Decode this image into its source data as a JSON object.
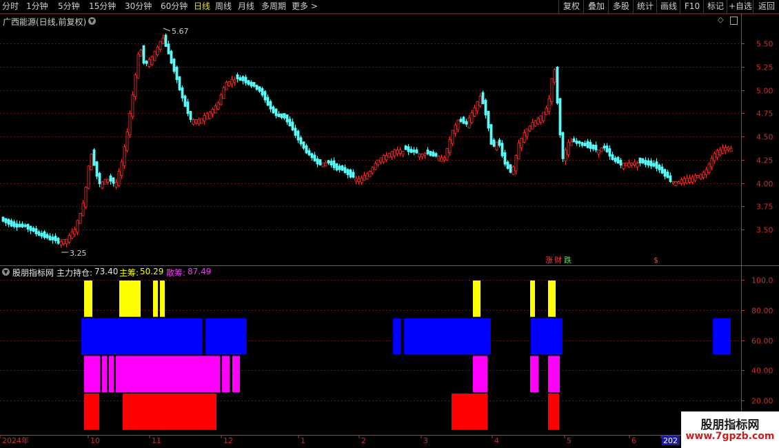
{
  "toolbar": {
    "periods": [
      {
        "label": "分时",
        "active": false
      },
      {
        "label": "1分钟",
        "active": false
      },
      {
        "label": "5分钟",
        "active": false
      },
      {
        "label": "15分钟",
        "active": false
      },
      {
        "label": "30分钟",
        "active": false
      },
      {
        "label": "60分钟",
        "active": false
      },
      {
        "label": "日线",
        "active": true
      },
      {
        "label": "周线",
        "active": false
      },
      {
        "label": "月线",
        "active": false
      },
      {
        "label": "多周期",
        "active": false
      },
      {
        "label": "更多 >",
        "active": false
      }
    ],
    "right_buttons": [
      "复权",
      "叠加",
      "多股",
      "统计",
      "画线",
      "F10",
      "标记",
      "+自选",
      "返回"
    ]
  },
  "main_chart": {
    "title": "广西能源(日线,前复权)",
    "y_ticks": [
      "5.50",
      "5.25",
      "5.00",
      "4.75",
      "4.50",
      "4.25",
      "4.00",
      "3.75",
      "3.50"
    ],
    "y_range": [
      3.25,
      5.8
    ],
    "high_label": "5.67",
    "low_label": "3.25",
    "event_labels": {
      "rise": "涨",
      "finance": "财",
      "fall": "跌",
      "dollar": "$"
    },
    "colors": {
      "up": "#ff3232",
      "down": "#54fcfc",
      "grid": "#8b1a1a",
      "axis": "#c83232"
    }
  },
  "indicator": {
    "name": "股朋指标网",
    "items": [
      {
        "label": "主力持仓:",
        "value": "73.40",
        "color": "#e8e8e8"
      },
      {
        "label": "主筹:",
        "value": "50.29",
        "color": "#ffff00"
      },
      {
        "label": "散筹:",
        "value": "87.49",
        "color": "#ff33ff"
      }
    ],
    "y_ticks": [
      "100.0",
      "80.00",
      "60.00",
      "40.00",
      "20.00"
    ],
    "y_range": [
      0,
      108
    ],
    "blocks": [
      {
        "color": "yellow",
        "x0": 122,
        "x1": 134,
        "y0": 75,
        "y1": 100
      },
      {
        "color": "yellow",
        "x0": 173,
        "x1": 204,
        "y0": 75,
        "y1": 100
      },
      {
        "color": "yellow",
        "x0": 222,
        "x1": 229,
        "y0": 75,
        "y1": 100
      },
      {
        "color": "yellow",
        "x0": 232,
        "x1": 239,
        "y0": 75,
        "y1": 100
      },
      {
        "color": "yellow",
        "x0": 686,
        "x1": 697,
        "y0": 75,
        "y1": 100
      },
      {
        "color": "yellow",
        "x0": 769,
        "x1": 776,
        "y0": 75,
        "y1": 100
      },
      {
        "color": "yellow",
        "x0": 795,
        "x1": 806,
        "y0": 75,
        "y1": 100
      },
      {
        "color": "blue",
        "x0": 118,
        "x1": 294,
        "y0": 50,
        "y1": 75
      },
      {
        "color": "blue",
        "x0": 298,
        "x1": 358,
        "y0": 50,
        "y1": 75
      },
      {
        "color": "blue",
        "x0": 570,
        "x1": 582,
        "y0": 50,
        "y1": 75
      },
      {
        "color": "blue",
        "x0": 586,
        "x1": 712,
        "y0": 50,
        "y1": 75
      },
      {
        "color": "blue",
        "x0": 770,
        "x1": 816,
        "y0": 50,
        "y1": 75
      },
      {
        "color": "blue",
        "x0": 1034,
        "x1": 1060,
        "y0": 50,
        "y1": 75
      },
      {
        "color": "magenta",
        "x0": 122,
        "x1": 145,
        "y0": 25,
        "y1": 50
      },
      {
        "color": "magenta",
        "x0": 148,
        "x1": 155,
        "y0": 25,
        "y1": 50
      },
      {
        "color": "magenta",
        "x0": 158,
        "x1": 165,
        "y0": 25,
        "y1": 50
      },
      {
        "color": "magenta",
        "x0": 168,
        "x1": 319,
        "y0": 25,
        "y1": 50
      },
      {
        "color": "magenta",
        "x0": 322,
        "x1": 333,
        "y0": 25,
        "y1": 50
      },
      {
        "color": "magenta",
        "x0": 337,
        "x1": 348,
        "y0": 25,
        "y1": 50
      },
      {
        "color": "magenta",
        "x0": 686,
        "x1": 707,
        "y0": 25,
        "y1": 50
      },
      {
        "color": "magenta",
        "x0": 769,
        "x1": 781,
        "y0": 25,
        "y1": 50
      },
      {
        "color": "magenta",
        "x0": 795,
        "x1": 812,
        "y0": 25,
        "y1": 50
      },
      {
        "color": "red",
        "x0": 122,
        "x1": 144,
        "y0": 0,
        "y1": 25
      },
      {
        "color": "red",
        "x0": 178,
        "x1": 314,
        "y0": 0,
        "y1": 25
      },
      {
        "color": "red",
        "x0": 655,
        "x1": 707,
        "y0": 0,
        "y1": 25
      },
      {
        "color": "red",
        "x0": 795,
        "x1": 811,
        "y0": 0,
        "y1": 25
      }
    ],
    "block_colors": {
      "yellow": "#ffff00",
      "blue": "#0000ff",
      "magenta": "#ff00ff",
      "red": "#ff0000"
    }
  },
  "time_axis": {
    "labels": [
      "2024年",
      "10",
      "11",
      "12",
      "1",
      "2",
      "3",
      "4",
      "5",
      "6",
      "202"
    ]
  },
  "watermark": {
    "title": "股朋指标网",
    "url": "www.7gpzb.com"
  }
}
